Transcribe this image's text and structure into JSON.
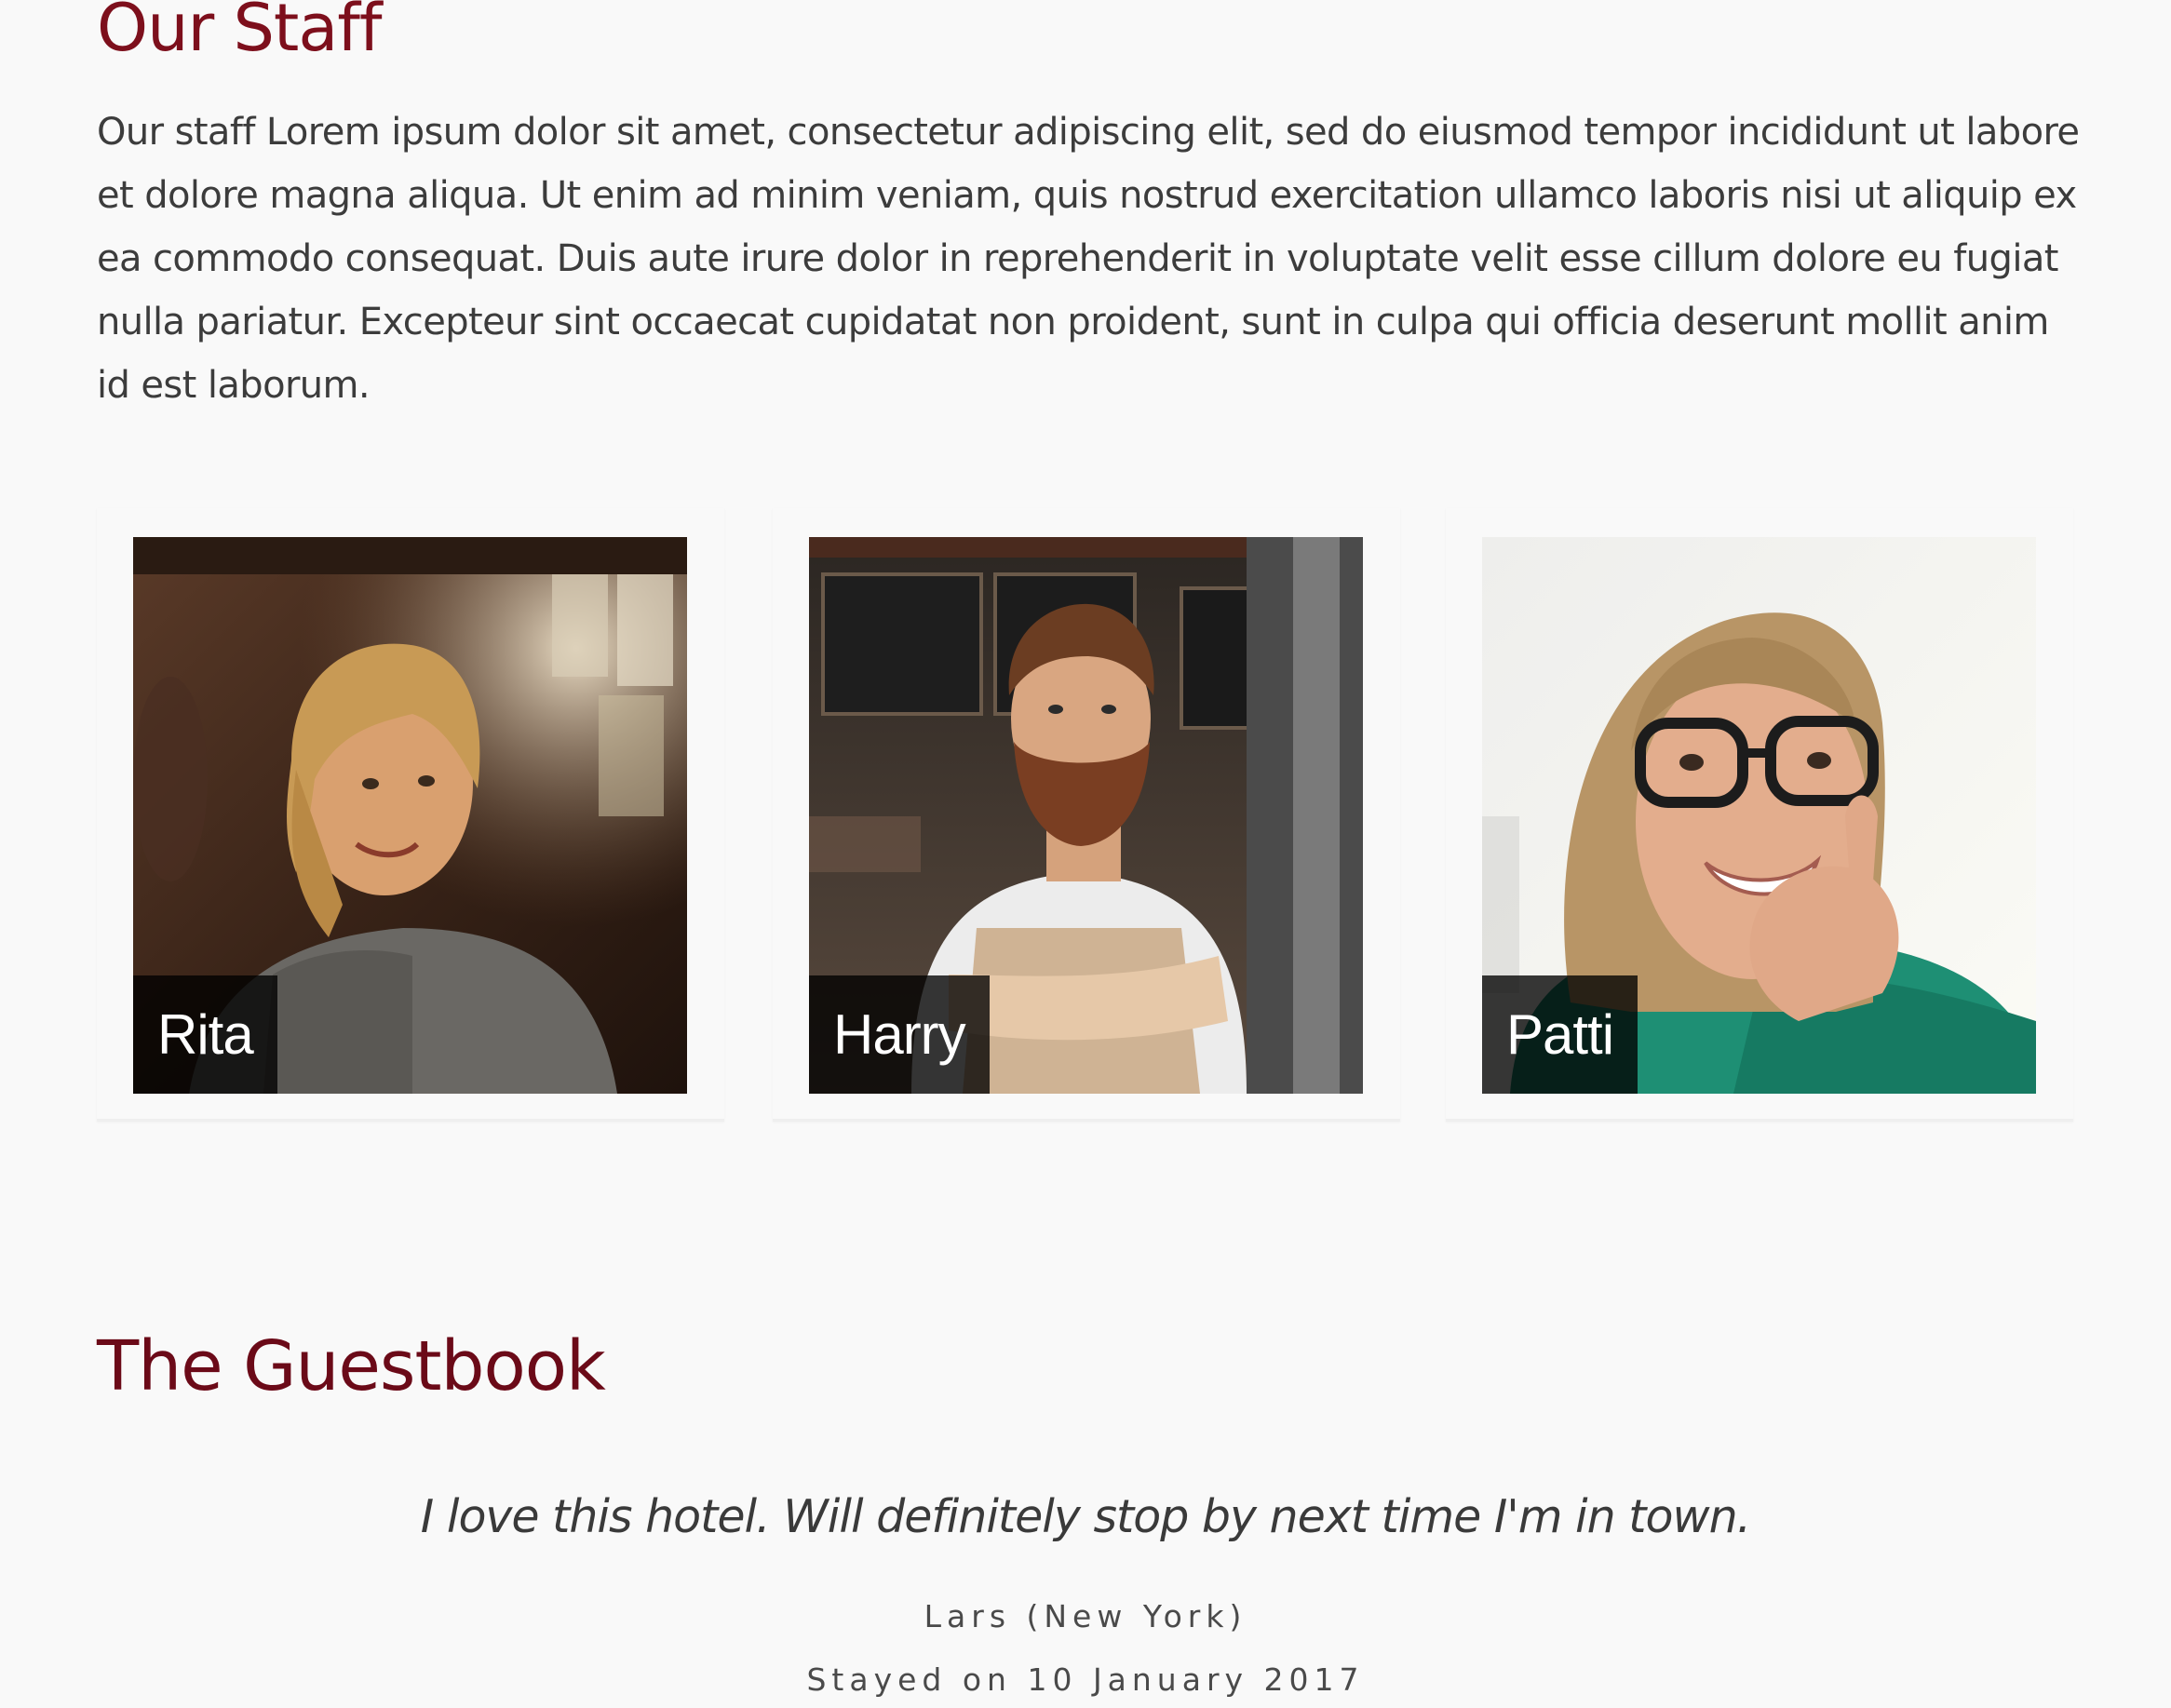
{
  "staff": {
    "heading": "Our Staff",
    "intro": "Our staff Lorem ipsum dolor sit amet, consectetur adipiscing elit, sed do eiusmod tempor incididunt ut labore et dolore magna aliqua. Ut enim ad minim veniam, quis nostrud exercitation ullamco laboris nisi ut aliquip ex ea commodo consequat. Duis aute irure dolor in reprehenderit in voluptate velit esse cillum dolore eu fugiat nulla pariatur. Excepteur sint occaecat cupidatat non proident, sunt in culpa qui officia deserunt mollit anim id est laborum.",
    "members": [
      {
        "name": "Rita"
      },
      {
        "name": "Harry"
      },
      {
        "name": "Patti"
      }
    ]
  },
  "guestbook": {
    "heading": "The Guestbook",
    "entries": [
      {
        "quote": "I love this hotel. Will definitely stop by next time I'm in town.",
        "author": "Lars (New York)",
        "stayed": "Stayed on 10 January 2017"
      }
    ]
  },
  "colors": {
    "heading": "#7d0f1c",
    "background": "#f9f9f9",
    "body_text": "#3c3c3c",
    "name_tag_bg": "#000000"
  }
}
